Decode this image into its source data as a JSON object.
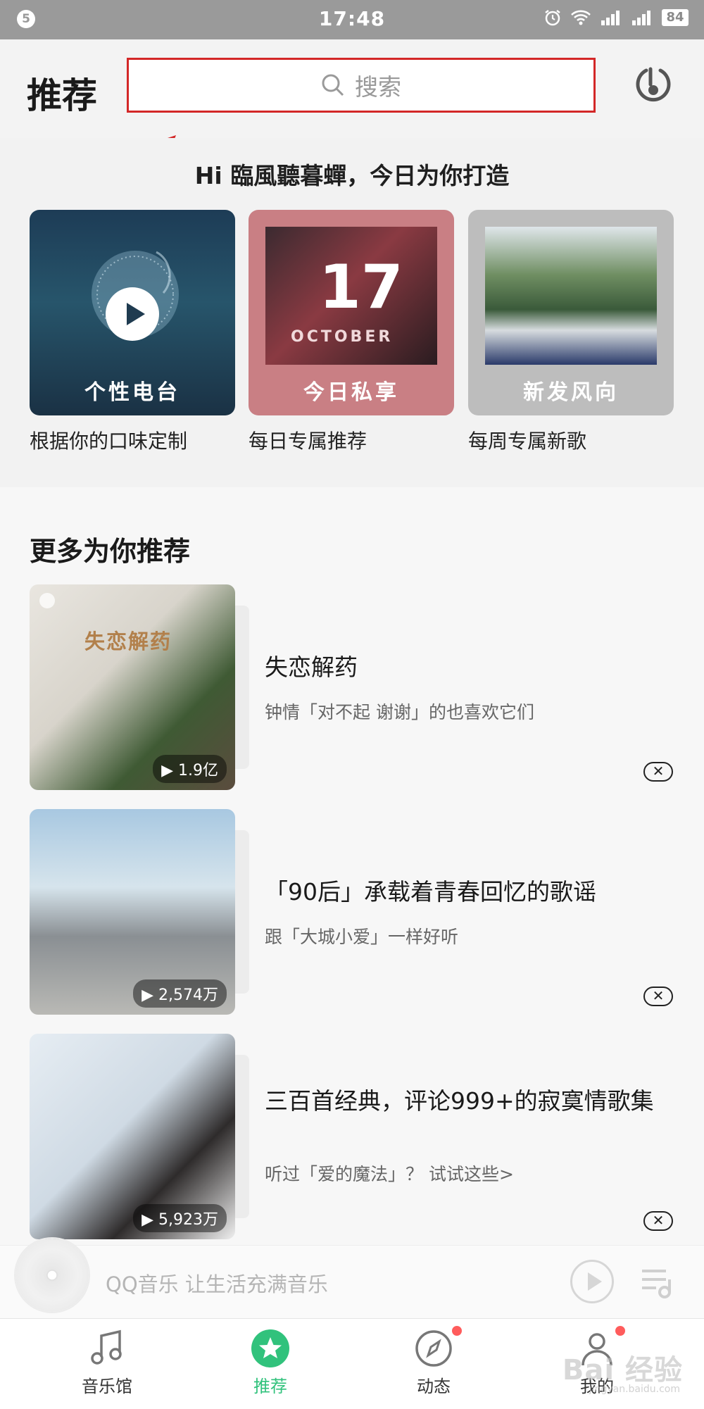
{
  "status_bar": {
    "notification_badge": "5",
    "time": "17:48",
    "battery": "84"
  },
  "header": {
    "title": "推荐",
    "search_placeholder": "搜索"
  },
  "greeting": "Hi 臨風聽暮蟬，今日为你打造",
  "top_cards": [
    {
      "label": "个性电台",
      "caption": "根据你的口味定制"
    },
    {
      "label": "今日私享",
      "caption": "每日专属推荐",
      "art_number": "17",
      "art_word": "OCTOBER"
    },
    {
      "label": "新发风向",
      "caption": "每周专属新歌"
    }
  ],
  "more_section": {
    "title": "更多为你推荐",
    "items": [
      {
        "cover_text": "失恋解药",
        "title": "失恋解药",
        "desc": "钟情「对不起 谢谢」的也喜欢它们",
        "play_count": "1.9亿"
      },
      {
        "title": "「90后」承载着青春回忆的歌谣",
        "desc": "跟「大城小爱」一样好听",
        "play_count": "2,574万"
      },
      {
        "title": "三百首经典，评论999+的寂寞情歌集",
        "desc": "听过「爱的魔法」？ 试试这些>",
        "play_count": "5,923万"
      }
    ]
  },
  "mini_player": {
    "text": "QQ音乐 让生活充满音乐"
  },
  "tab_bar": {
    "tabs": [
      {
        "label": "音乐馆",
        "icon": "music-note-icon"
      },
      {
        "label": "推荐",
        "icon": "star-icon",
        "active": true
      },
      {
        "label": "动态",
        "icon": "compass-icon",
        "badge": true
      },
      {
        "label": "我的",
        "icon": "person-icon",
        "badge": true
      }
    ]
  },
  "watermark": {
    "text": "Bai 经验",
    "sub": "jingyan.baidu.com"
  },
  "colors": {
    "accent": "#31c27c",
    "annotation_red": "#d32727",
    "badge_red": "#ff5c5c"
  }
}
